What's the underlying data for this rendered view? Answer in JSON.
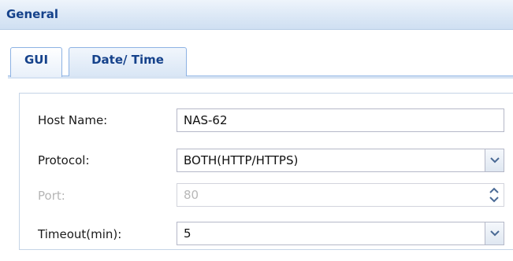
{
  "panel": {
    "title": "General"
  },
  "tabs": [
    {
      "label": "GUI",
      "active": true
    },
    {
      "label": "Date/ Time",
      "active": false
    }
  ],
  "form": {
    "host_name": {
      "label": "Host Name:",
      "value": "NAS-62"
    },
    "protocol": {
      "label": "Protocol:",
      "value": "BOTH(HTTP/HTTPS)"
    },
    "port": {
      "label": "Port:",
      "value": "80",
      "disabled": true
    },
    "timeout": {
      "label": "Timeout(min):",
      "value": "5"
    }
  },
  "colors": {
    "header_text": "#15428b",
    "tab_border": "#8db2e3",
    "field_border": "#b5b8c8",
    "disabled_text": "#b5b5b5"
  },
  "icons": {
    "dropdown": "chevron-down-icon",
    "spin_up": "caret-up-icon",
    "spin_down": "caret-down-icon"
  }
}
